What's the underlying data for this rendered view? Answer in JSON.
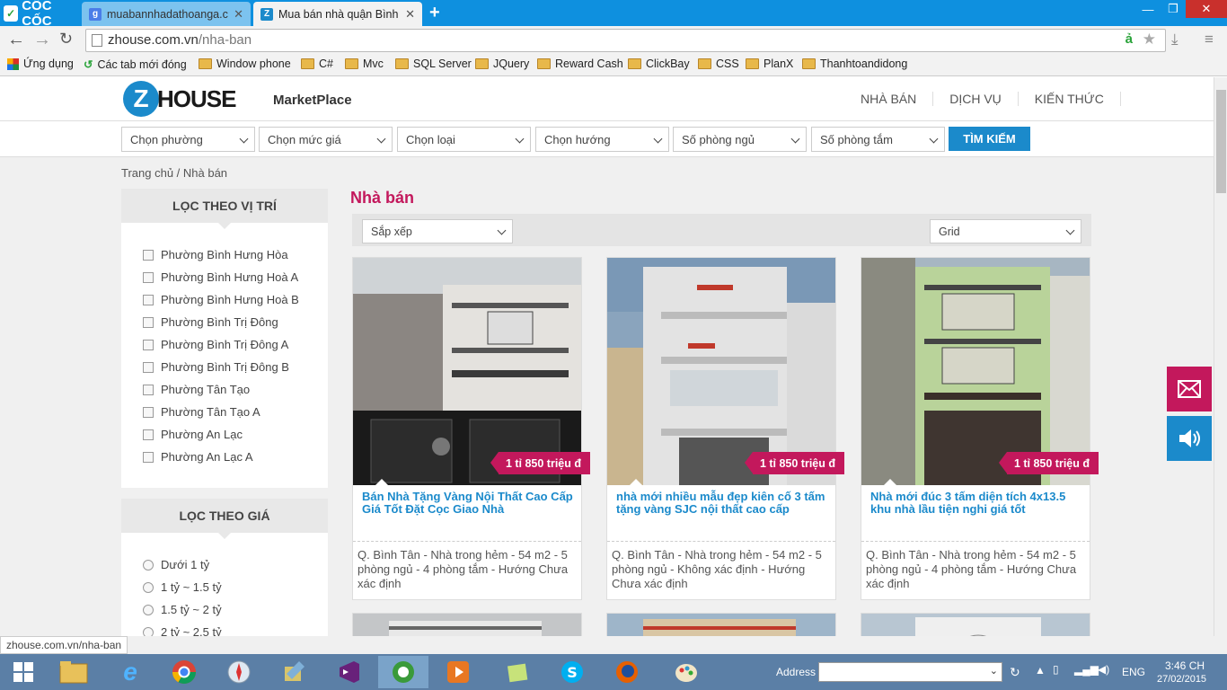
{
  "browser": {
    "brand": "CỐC CỐC",
    "tabs": [
      {
        "title": "muabannhadathoanga.co"
      },
      {
        "title": "Mua bán nhà quận Bình Tâ"
      }
    ],
    "url_domain": "zhouse.com.vn",
    "url_path": "/nha-ban",
    "bookmarks": [
      "Ứng dụng",
      "Các tab mới đóng",
      "Window phone",
      "C#",
      "Mvc",
      "SQL Server",
      "JQuery",
      "Reward Cash",
      "ClickBay",
      "CSS",
      "PlanX",
      "Thanhtoandidong"
    ]
  },
  "site": {
    "logo_z": "Z",
    "logo_text": "HOUSE",
    "marketplace": "MarketPlace",
    "nav": [
      "NHÀ BÁN",
      "DỊCH VỤ",
      "KIẾN THỨC"
    ],
    "filters": [
      "Chọn phường",
      "Chọn mức giá",
      "Chọn loại",
      "Chọn hướng",
      "Số phòng ngủ",
      "Số phòng tắm"
    ],
    "search_button": "TÌM KIẾM",
    "breadcrumb": "Trang chủ / Nhà bán",
    "sidebar": {
      "location_title": "LỌC THEO VỊ TRÍ",
      "locations": [
        "Phường Bình Hưng Hòa",
        "Phường Bình Hưng Hoà A",
        "Phường Bình Hưng Hoà B",
        "Phường Bình Trị Đông",
        "Phường Bình Trị Đông A",
        "Phường Bình Trị Đông B",
        "Phường Tân Tạo",
        "Phường Tân Tạo A",
        "Phường An Lạc",
        "Phường An Lạc A"
      ],
      "price_title": "LỌC THEO GIÁ",
      "prices": [
        "Dưới 1 tỷ",
        "1 tỷ ~ 1.5 tỷ",
        "1.5 tỷ ~ 2 tỷ",
        "2 tỷ ~ 2.5 tỷ"
      ]
    },
    "section_title": "Nhà bán",
    "sort_label": "Sắp xếp",
    "view_label": "Grid",
    "listings": [
      {
        "price": "1 tỉ 850 triệu đ",
        "title": "Bán Nhà Tặng Vàng Nội Thất Cao Cấp Giá Tốt Đặt Cọc Giao Nhà",
        "desc": "Q. Bình Tân - Nhà trong hẻm - 54 m2 - 5 phòng ngủ - 4 phòng tắm - Hướng Chưa xác định"
      },
      {
        "price": "1 tỉ 850 triệu đ",
        "title": "nhà mới nhiều mẫu đẹp kiên cố 3 tấm tặng vàng SJC nội thất cao cấp",
        "desc": "Q. Bình Tân - Nhà trong hẻm - 54 m2 - 5 phòng ngủ - Không xác định - Hướng Chưa xác định"
      },
      {
        "price": "1 tỉ 850 triệu đ",
        "title": "Nhà mới đúc 3 tấm diện tích 4x13.5 khu nhà lầu tiện nghi giá tốt",
        "desc": "Q. Bình Tân - Nhà trong hẻm - 54 m2 - 5 phòng ngủ - 4 phòng tắm - Hướng Chưa xác định"
      }
    ]
  },
  "status_url": "zhouse.com.vn/nha-ban",
  "taskbar": {
    "address_label": "Address",
    "language": "ENG",
    "time": "3:46 CH",
    "date": "27/02/2015"
  },
  "colors": {
    "accent": "#c3185c",
    "brand_blue": "#1b8acb",
    "chrome_blue": "#0e90df"
  }
}
